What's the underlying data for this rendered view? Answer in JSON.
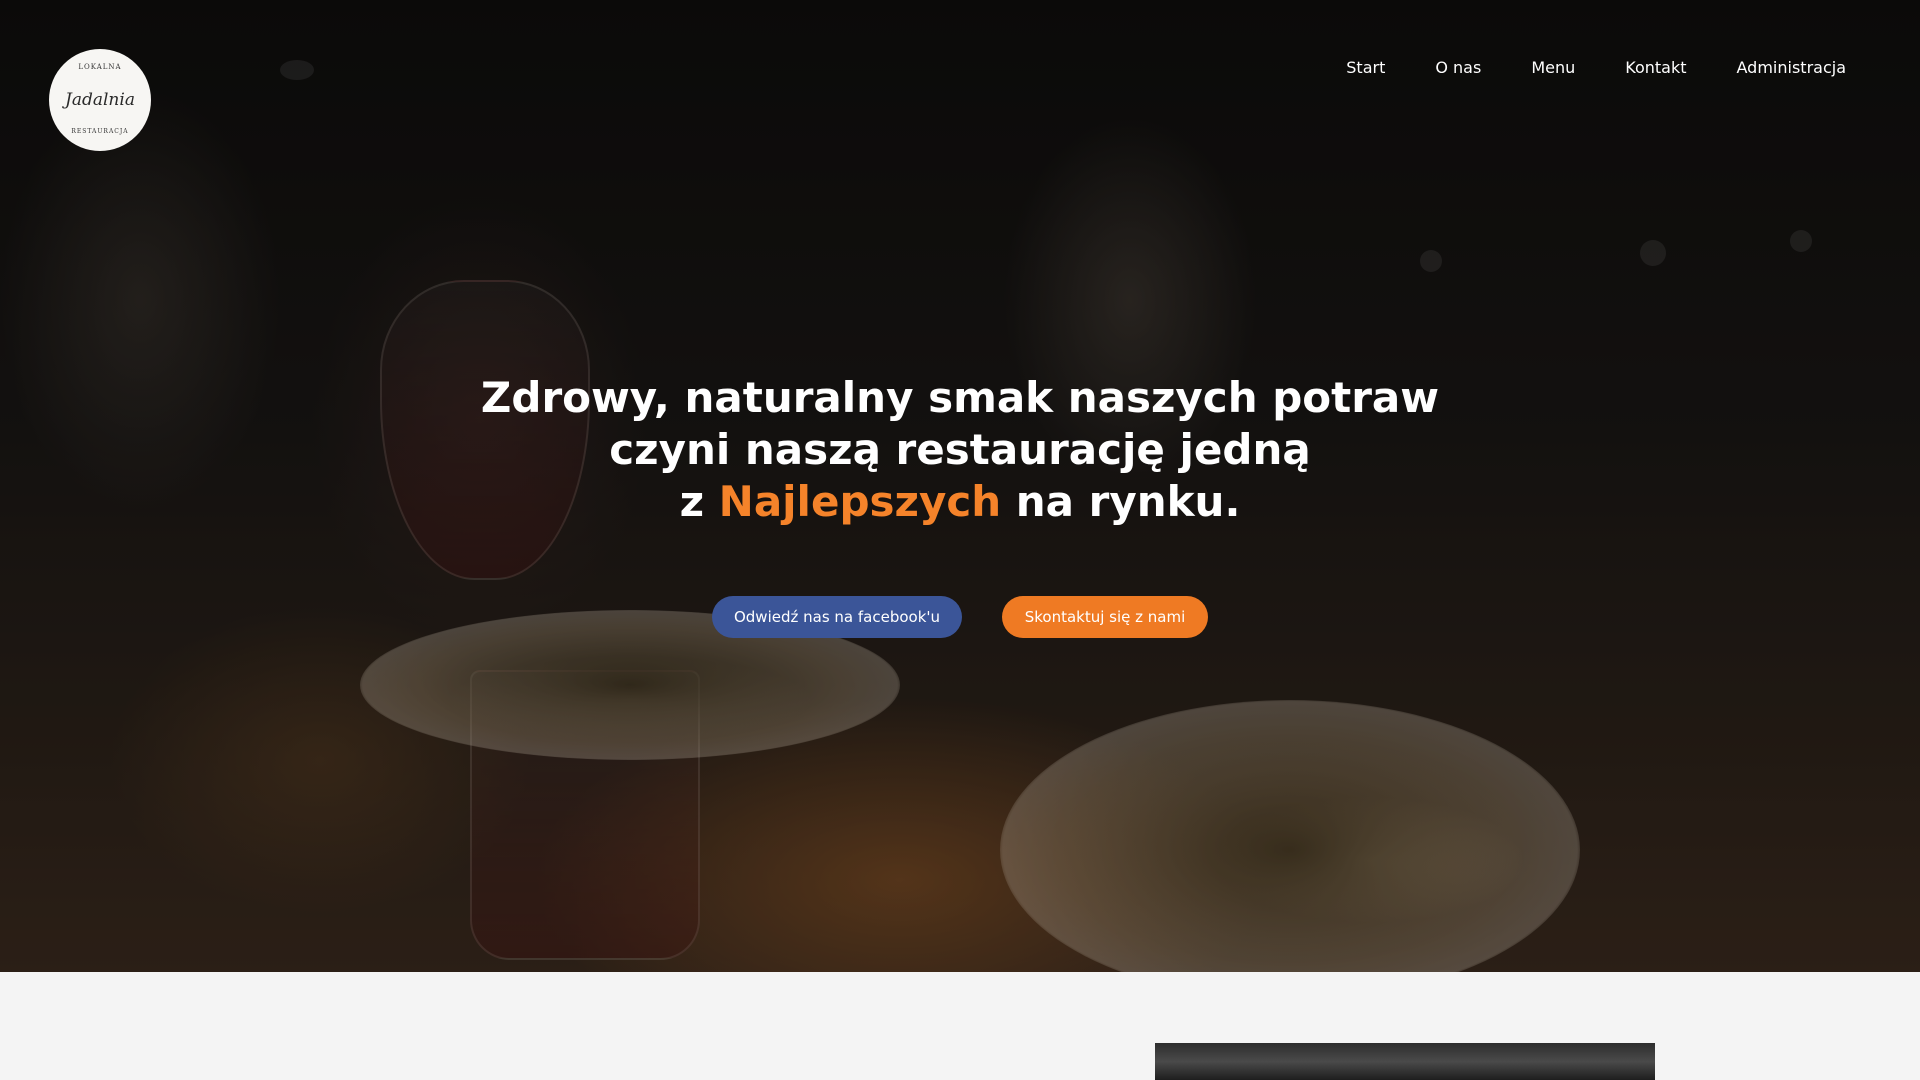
{
  "logo": {
    "top_text": "LOKALNA",
    "script_text": "Jadalnia",
    "bottom_text": "RESTAURACJA"
  },
  "nav": {
    "items": [
      {
        "label": "Start"
      },
      {
        "label": "O nas"
      },
      {
        "label": "Menu"
      },
      {
        "label": "Kontakt"
      },
      {
        "label": "Administracja"
      }
    ]
  },
  "hero": {
    "line1": "Zdrowy, naturalny smak naszych potraw",
    "line2": "czyni naszą restaurację jedną",
    "line3_prefix": "z ",
    "line3_accent": "Najlepszych",
    "line3_suffix": " na rynku.",
    "facebook_button": "Odwiedź nas na facebook'u",
    "contact_button": "Skontaktuj się z nami"
  },
  "colors": {
    "accent": "#f5832a",
    "facebook": "#3b5598",
    "contact_button": "#ef7a23",
    "page_background": "#f4f4f4"
  }
}
